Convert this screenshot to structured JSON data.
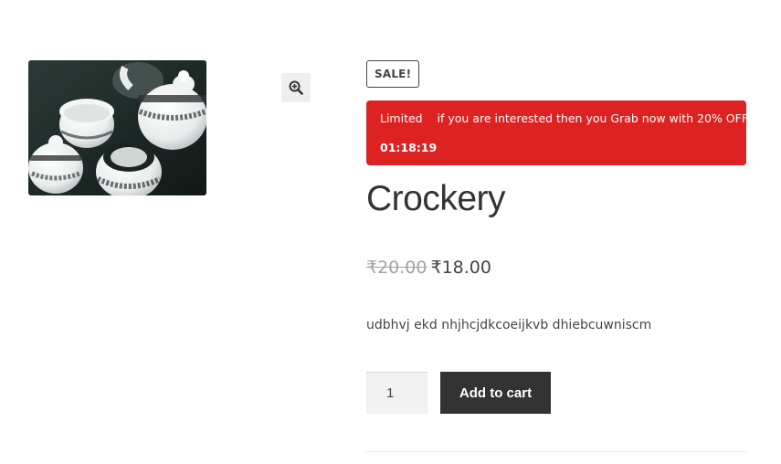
{
  "gallery": {
    "image_alt": "Crockery tea set",
    "zoom_icon": "zoom-in-icon"
  },
  "product": {
    "sale_badge": "SALE!",
    "countdown": {
      "message": "Limited    if you are interested then you Grab now with 20% OFF",
      "timer": "01:18:19",
      "background": "#dd2222"
    },
    "title": "Crockery",
    "price": {
      "regular": "₹20.00",
      "sale": "₹18.00"
    },
    "short_description": "udbhvj ekd nhjhcjdkcoeijkvb dhiebcuwniscm",
    "quantity": "1",
    "add_to_cart_label": "Add to cart"
  },
  "colors": {
    "button": "#333333",
    "text": "#43454b",
    "qty_bg": "#f2f2f2"
  }
}
